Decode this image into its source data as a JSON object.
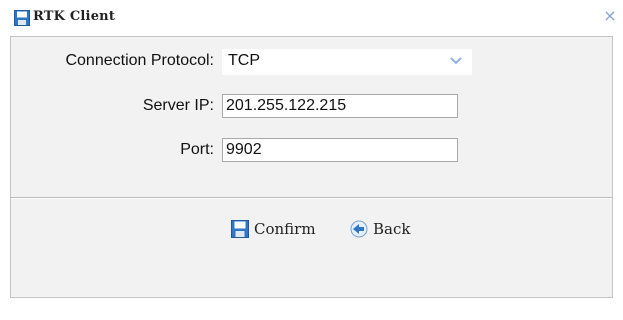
{
  "window": {
    "title": "RTK Client",
    "close_glyph": "×",
    "title_icon": "save-icon"
  },
  "form": {
    "protocol": {
      "label": "Connection Protocol:",
      "value": "TCP"
    },
    "server_ip": {
      "label": "Server IP:",
      "value": "201.255.122.215"
    },
    "port": {
      "label": "Port:",
      "value": "9902"
    }
  },
  "actions": {
    "confirm": {
      "label": "Confirm",
      "icon": "save-icon"
    },
    "back": {
      "label": "Back",
      "icon": "back-arrow-icon"
    }
  },
  "colors": {
    "icon_blue": "#2f76c7",
    "arrow_blue": "#8fb4dc",
    "panel_bg": "#f2f2f2"
  }
}
